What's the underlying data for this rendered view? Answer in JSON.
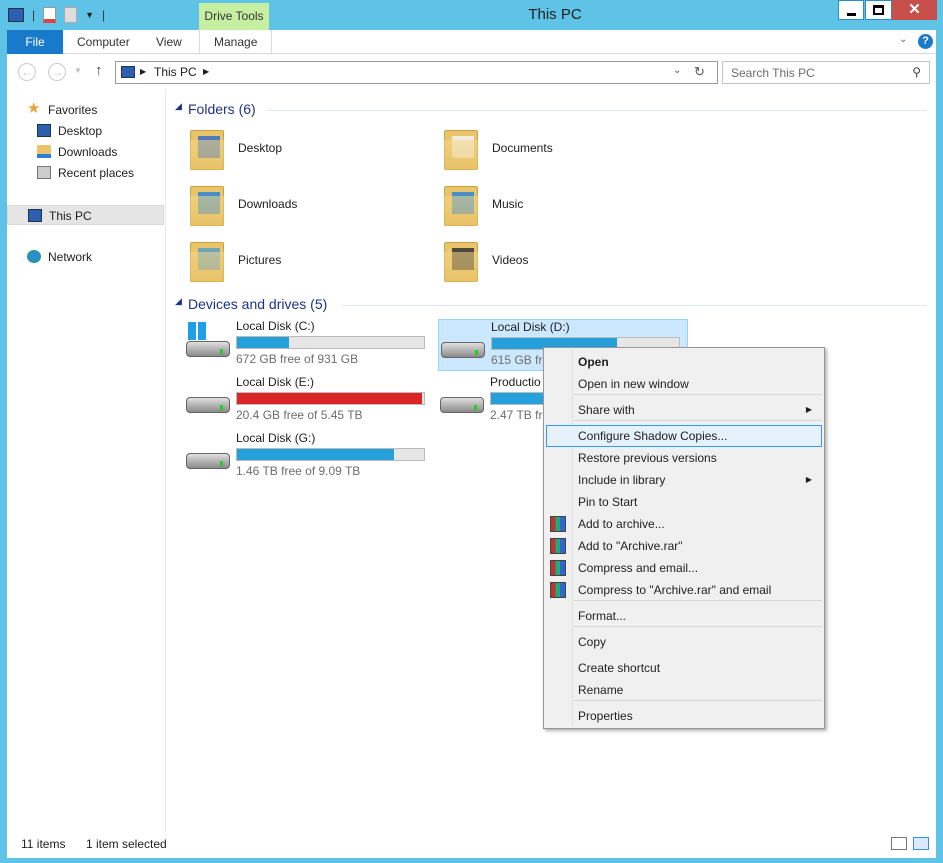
{
  "window": {
    "title": "This PC",
    "context_tab": "Drive Tools"
  },
  "ribbon": {
    "tabs": [
      "File",
      "Computer",
      "View",
      "Manage"
    ]
  },
  "nav": {
    "address": "This PC",
    "search_placeholder": "Search This PC"
  },
  "sidebar": {
    "items": [
      {
        "label": "Favorites",
        "icon": "star-icon"
      },
      {
        "label": "Desktop",
        "icon": "desktop-icon"
      },
      {
        "label": "Downloads",
        "icon": "downloads-icon"
      },
      {
        "label": "Recent places",
        "icon": "recent-places-icon"
      },
      {
        "label": "This PC",
        "icon": "computer-icon",
        "selected": true
      },
      {
        "label": "Network",
        "icon": "network-icon"
      }
    ]
  },
  "folders": {
    "header": "Folders (6)",
    "items": [
      "Desktop",
      "Documents",
      "Downloads",
      "Music",
      "Pictures",
      "Videos"
    ]
  },
  "drives": {
    "header": "Devices and drives (5)",
    "items": [
      {
        "name": "Local Disk (C:)",
        "free": "672 GB free of 931 GB",
        "used_percent": 28,
        "color": "#26a0da"
      },
      {
        "name": "Local Disk (D:)",
        "free": "615 GB fre",
        "used_percent": 67,
        "color": "#26a0da",
        "selected": true
      },
      {
        "name": "Local Disk (E:)",
        "free": "20.4 GB free of 5.45 TB",
        "used_percent": 99,
        "color": "#da2626"
      },
      {
        "name": "Productio",
        "free": "2.47 TB fre",
        "used_percent": 55,
        "color": "#26a0da"
      },
      {
        "name": "Local Disk (G:)",
        "free": "1.46 TB free of 9.09 TB",
        "used_percent": 84,
        "color": "#26a0da"
      }
    ]
  },
  "context_menu": {
    "items": [
      "Open",
      "Open in new window",
      "Share with",
      "Configure Shadow Copies...",
      "Restore previous versions",
      "Include in library",
      "Pin to Start",
      "Add to archive...",
      "Add to \"Archive.rar\"",
      "Compress and email...",
      "Compress to \"Archive.rar\" and email",
      "Format...",
      "Copy",
      "Create shortcut",
      "Rename",
      "Properties"
    ]
  },
  "status": {
    "items": "11 items",
    "selected": "1 item selected"
  }
}
